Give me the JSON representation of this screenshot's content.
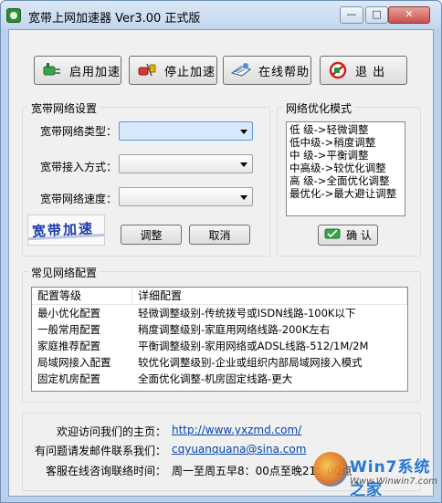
{
  "window": {
    "title": "宽带上网加速器  Ver3.00 正式版",
    "controls": {
      "minimize": "—",
      "maximize": "□",
      "close": "✕"
    }
  },
  "toolbar": {
    "enable_label": "启用加速",
    "stop_label": "停止加速",
    "help_label": "在线帮助",
    "exit_label": "退  出"
  },
  "settings": {
    "group_title": "宽带网络设置",
    "network_type_label": "宽带网络类型：",
    "access_method_label": "宽带接入方式：",
    "network_speed_label": "宽带网络速度：",
    "network_type_value": "",
    "access_method_value": "",
    "network_speed_value": "",
    "stamp_text": "宽带加速",
    "adjust_label": "调整",
    "cancel_label": "取消"
  },
  "mode": {
    "group_title": "网络优化模式",
    "items": [
      "低  级->轻微调整",
      "低中级->稍度调整",
      "中  级->平衡调整",
      "中高级->较优化调整",
      "高  级->全面优化调整",
      "最优化->最大避让调整"
    ],
    "confirm_label": "确 认"
  },
  "common": {
    "group_title": "常见网络配置",
    "columns": [
      "配置等级",
      "详细配置"
    ],
    "rows": [
      [
        "最小优化配置",
        "轻微调整级别-传统拨号或ISDN线路-100K以下"
      ],
      [
        "一般常用配置",
        "稍度调整级别-家庭用网络线路-200K左右"
      ],
      [
        "家庭推荐配置",
        "平衡调整级别-家用网络或ADSL线路-512/1M/2M"
      ],
      [
        "局域网接入配置",
        "较优化调整级别-企业或组织内部局域网接入模式"
      ],
      [
        "固定机房配置",
        "全面优化调整-机房固定线路-更大"
      ]
    ]
  },
  "contact": {
    "homepage_label": "欢迎访问我们的主页：",
    "homepage_value": "http://www.yxzmd.com/",
    "email_label": "有问题请发邮件联系我们：",
    "email_value": "cqyuanquana@sina.com",
    "hours_label": "客服在线咨询联络时间：",
    "hours_value": "周一至周五早8：00点至晚21：00点"
  },
  "watermark": {
    "text": "Win7系统之家",
    "sub": "Www.Winwin7.com"
  },
  "colors": {
    "window_frame": "#b9d1ea",
    "client_bg": "#f0f0f0",
    "link": "#0645ad",
    "focused_combo": "#d8e8f8"
  }
}
